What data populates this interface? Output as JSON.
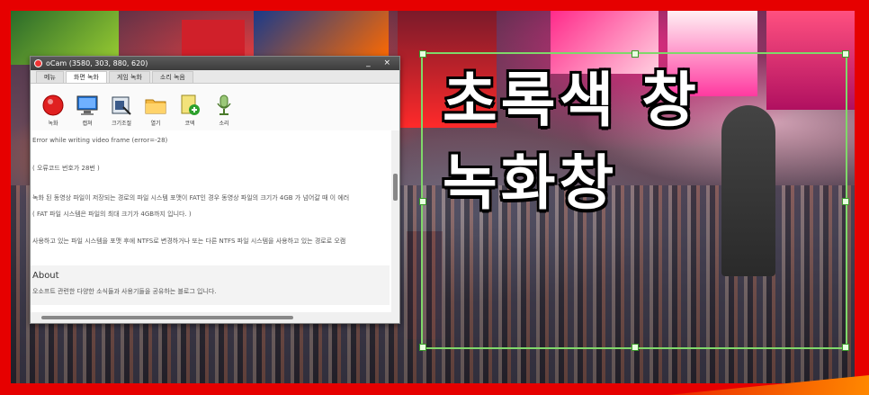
{
  "window": {
    "title": "oCam (3580, 303, 880, 620)",
    "controls": "_ ×",
    "tabs": [
      {
        "label": "메뉴",
        "active": false
      },
      {
        "label": "화면 녹화",
        "active": true
      },
      {
        "label": "게임 녹화",
        "active": false
      },
      {
        "label": "소리 녹음",
        "active": false
      }
    ],
    "tools": [
      {
        "label": "녹화",
        "icon": "record-icon"
      },
      {
        "label": "캡쳐",
        "icon": "monitor-capture-icon"
      },
      {
        "label": "크기조절",
        "icon": "resize-icon"
      },
      {
        "label": "열기",
        "icon": "folder-icon"
      },
      {
        "label": "코덱",
        "icon": "codec-icon"
      },
      {
        "label": "소리",
        "icon": "microphone-icon"
      }
    ],
    "content": {
      "line1": "Error while writing video frame (error=-28)",
      "line2": "( 오류코드 번호가 28번 )",
      "line3": "녹화 된 동영상 파일이 저장되는 경로의 파일 시스템 포맷이 FAT인 경우 동영상 파일의 크기가 4GB 가 넘어갈 때 이 에러",
      "line4": "( FAT 파일 시스템은 파일의 최대 크기가 4GB까지 입니다. )",
      "line5": "사용하고 있는 파일 시스템을 포맷 후에 NTFS로 변경하거나 또는 다른 NTFS 파일 시스템을 사용하고 있는 경로로 오캠",
      "about_heading": "About",
      "about_text": "오소프트 관련한 다양한 소식들과 사용기들을 공유하는 블로그 입니다."
    }
  },
  "overlay": {
    "line1": "초록색 창",
    "line2": "녹화창"
  },
  "colors": {
    "border_red": "#e60000",
    "selection_green": "#7fd86a"
  }
}
